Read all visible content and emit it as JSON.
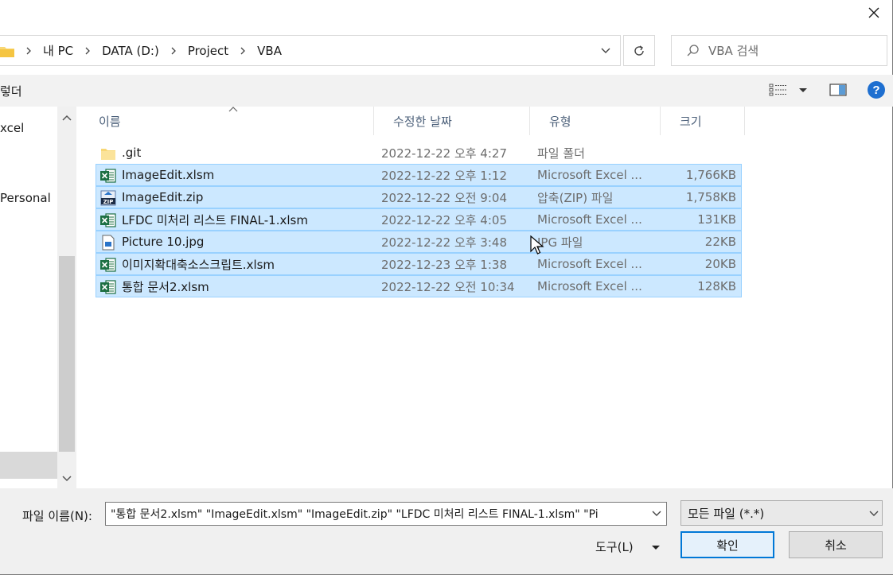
{
  "address": {
    "crumbs": [
      "내 PC",
      "DATA (D:)",
      "Project",
      "VBA"
    ]
  },
  "search": {
    "placeholder": "VBA 검색"
  },
  "toolbar": {
    "left_label": "렇더"
  },
  "nav": {
    "items": [
      "xcel",
      "Personal"
    ]
  },
  "columns": {
    "name": "이름",
    "date": "수정한 날짜",
    "type": "유형",
    "size": "크기"
  },
  "files": [
    {
      "name": ".git",
      "date": "2022-12-22 오후 4:27",
      "type": "파일 폴더",
      "size": "",
      "icon": "folder-icon",
      "selected": false
    },
    {
      "name": "ImageEdit.xlsm",
      "date": "2022-12-22 오후 1:12",
      "type": "Microsoft Excel ...",
      "size": "1,766KB",
      "icon": "excel-icon",
      "selected": true
    },
    {
      "name": "ImageEdit.zip",
      "date": "2022-12-22 오전 9:04",
      "type": "압축(ZIP) 파일",
      "size": "1,758KB",
      "icon": "zip-icon",
      "selected": true
    },
    {
      "name": "LFDC 미처리 리스트 FINAL-1.xlsm",
      "date": "2022-12-22 오후 4:05",
      "type": "Microsoft Excel ...",
      "size": "131KB",
      "icon": "excel-icon",
      "selected": true
    },
    {
      "name": "Picture 10.jpg",
      "date": "2022-12-22 오후 3:48",
      "type": "JPG 파일",
      "size": "22KB",
      "icon": "image-icon",
      "selected": true
    },
    {
      "name": "이미지확대축소스크립트.xlsm",
      "date": "2022-12-23 오후 1:38",
      "type": "Microsoft Excel ...",
      "size": "20KB",
      "icon": "excel-icon",
      "selected": true
    },
    {
      "name": "통합 문서2.xlsm",
      "date": "2022-12-22 오전 10:34",
      "type": "Microsoft Excel ...",
      "size": "128KB",
      "icon": "excel-icon",
      "selected": true
    }
  ],
  "footer": {
    "filename_label": "파일 이름(N):",
    "filename_value": "\"통합 문서2.xlsm\" \"ImageEdit.xlsm\" \"ImageEdit.zip\" \"LFDC 미처리 리스트 FINAL-1.xlsm\" \"Pi",
    "filter_value": "모든 파일 (*.*)",
    "tools_label": "도구(L)",
    "ok_label": "확인",
    "cancel_label": "취소"
  },
  "colors": {
    "selection_bg": "#cce8ff",
    "selection_border": "#99d1ff",
    "accent": "#0078d7",
    "excel_green": "#1d6f42",
    "folder_yellow": "#f8d775"
  }
}
